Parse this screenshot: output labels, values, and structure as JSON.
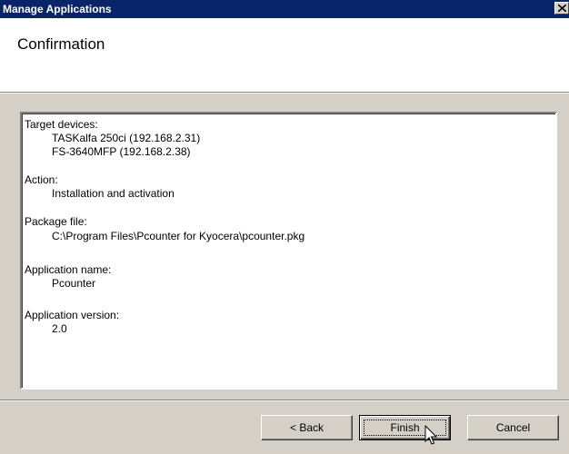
{
  "window": {
    "title": "Manage Applications",
    "close_icon": "close-icon"
  },
  "header": {
    "heading": "Confirmation"
  },
  "summary": {
    "target_devices_label": "Target devices:",
    "target_devices": [
      "TASKalfa 250ci (192.168.2.31)",
      "FS-3640MFP (192.168.2.38)"
    ],
    "action_label": "Action:",
    "action_value": "Installation and activation",
    "package_file_label": "Package file:",
    "package_file_value": "C:\\Program Files\\Pcounter for Kyocera\\pcounter.pkg",
    "app_name_label": "Application name:",
    "app_name_value": "Pcounter",
    "app_version_label": "Application version:",
    "app_version_value": "2.0"
  },
  "buttons": {
    "back": "< Back",
    "finish": "Finish",
    "cancel": "Cancel"
  },
  "colors": {
    "titlebar": "#0a246a",
    "dialog": "#d4d0c8"
  }
}
